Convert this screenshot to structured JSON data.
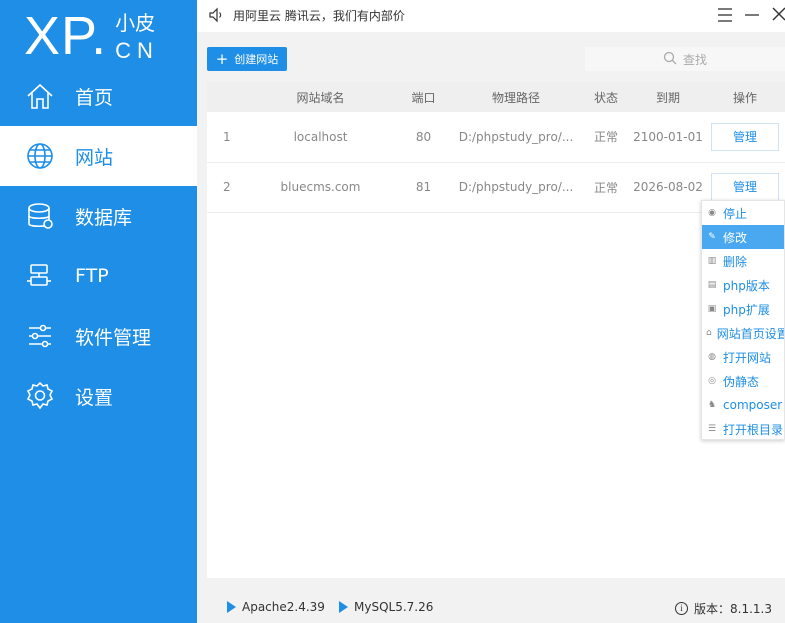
{
  "logo": {
    "main": "XP.",
    "small": "小皮",
    "cn": "CN"
  },
  "sidebar": {
    "items": [
      {
        "label": "首页",
        "icon": "home-icon"
      },
      {
        "label": "网站",
        "icon": "globe-icon",
        "active": true
      },
      {
        "label": "数据库",
        "icon": "database-icon"
      },
      {
        "label": "FTP",
        "icon": "ftp-icon"
      },
      {
        "label": "软件管理",
        "icon": "sliders-icon"
      },
      {
        "label": "设置",
        "icon": "gear-icon"
      }
    ]
  },
  "header": {
    "notice": "用阿里云 腾讯云，我们有内部价"
  },
  "toolbar": {
    "create_label": "创建网站",
    "search_placeholder": "查找"
  },
  "table": {
    "columns": [
      "",
      "网站域名",
      "端口",
      "物理路径",
      "状态",
      "到期",
      "操作"
    ],
    "rows": [
      {
        "index": "1",
        "domain": "localhost",
        "port": "80",
        "path": "D:/phpstudy_pro/...",
        "status": "正常",
        "expire": "2100-01-01",
        "action": "管理"
      },
      {
        "index": "2",
        "domain": "bluecms.com",
        "port": "81",
        "path": "D:/phpstudy_pro/...",
        "status": "正常",
        "expire": "2026-08-02",
        "action": "管理"
      }
    ]
  },
  "dropdown": {
    "items": [
      {
        "label": "停止",
        "icon": "stop-icon",
        "glyph": "◉"
      },
      {
        "label": "修改",
        "icon": "pencil-icon",
        "glyph": "✎",
        "highlighted": true
      },
      {
        "label": "删除",
        "icon": "trash-icon",
        "glyph": "▥"
      },
      {
        "label": "php版本",
        "icon": "file-icon",
        "glyph": "▤"
      },
      {
        "label": "php扩展",
        "icon": "extension-icon",
        "glyph": "▣"
      },
      {
        "label": "网站首页设置",
        "icon": "home-icon",
        "glyph": "⌂"
      },
      {
        "label": "打开网站",
        "icon": "globe-icon",
        "glyph": "◍"
      },
      {
        "label": "伪静态",
        "icon": "refresh-icon",
        "glyph": "◎"
      },
      {
        "label": "composer",
        "icon": "composer-icon",
        "glyph": "♞"
      },
      {
        "label": "打开根目录",
        "icon": "list-icon",
        "glyph": "☰"
      }
    ]
  },
  "footer": {
    "apache": "Apache2.4.39",
    "mysql": "MySQL5.7.26",
    "version_label": "版本：",
    "version": "8.1.1.3"
  },
  "colors": {
    "accent": "#1e8ee6",
    "highlight": "#4aa8f0"
  }
}
